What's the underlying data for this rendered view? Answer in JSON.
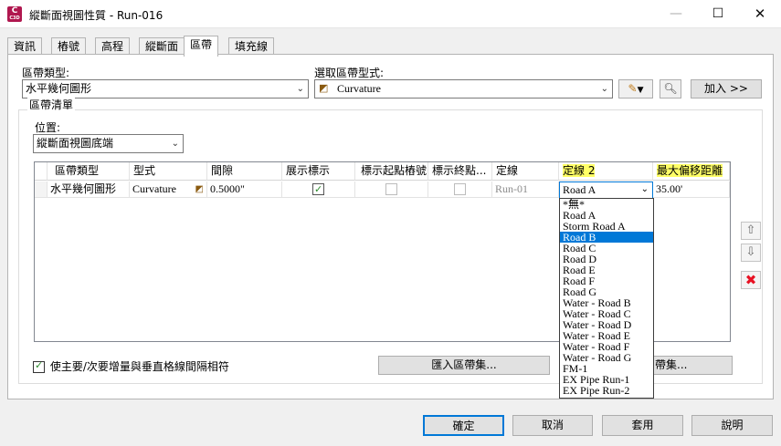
{
  "window": {
    "title": "縱斷面視圖性質 - Run-016",
    "app_icon": {
      "letter": "C",
      "version": "C3D"
    }
  },
  "tabs": [
    "資訊",
    "樁號",
    "高程",
    "縱斷面",
    "區帶",
    "填充線"
  ],
  "active_tab": 4,
  "band_type": {
    "label": "區帶類型:",
    "value": "水平幾何圖形"
  },
  "band_style": {
    "label": "選取區帶型式:",
    "value": "Curvature",
    "add_button": "加入 >>"
  },
  "band_list_title": "區帶清單",
  "location": {
    "label": "位置:",
    "value": "縱斷面視圖底端"
  },
  "grid": {
    "headers": [
      "區帶類型",
      "型式",
      "間隙",
      "展示標示",
      "標示起點樁號",
      "標示終點...",
      "定線",
      "定線 2",
      "最大偏移距離"
    ],
    "row": {
      "type": "水平幾何圖形",
      "style": "Curvature",
      "gap": "0.5000\"",
      "alignment": "Run-01",
      "alignment2": "Road A",
      "max_offset": "35.00'"
    }
  },
  "dropdown_items": [
    "*無*",
    "Road A",
    "Storm Road A",
    "Road B",
    "Road C",
    "Road D",
    "Road E",
    "Road F",
    "Road G",
    "Water - Road B",
    "Water - Road C",
    "Water - Road D",
    "Water - Road E",
    "Water - Road F",
    "Water - Road G",
    "FM-1",
    "EX Pipe Run-1",
    "EX Pipe Run-2"
  ],
  "dropdown_selected": 3,
  "match_checkbox": "使主要/次要增量與垂直格線間隔相符",
  "import_button": "匯入區帶集...",
  "save_button_partial": "帶集...",
  "footer": {
    "ok": "確定",
    "cancel": "取消",
    "apply": "套用",
    "help": "說明"
  },
  "colors": {
    "accent": "#0078d7",
    "highlight": "#ffff66",
    "delete": "#e81123"
  }
}
